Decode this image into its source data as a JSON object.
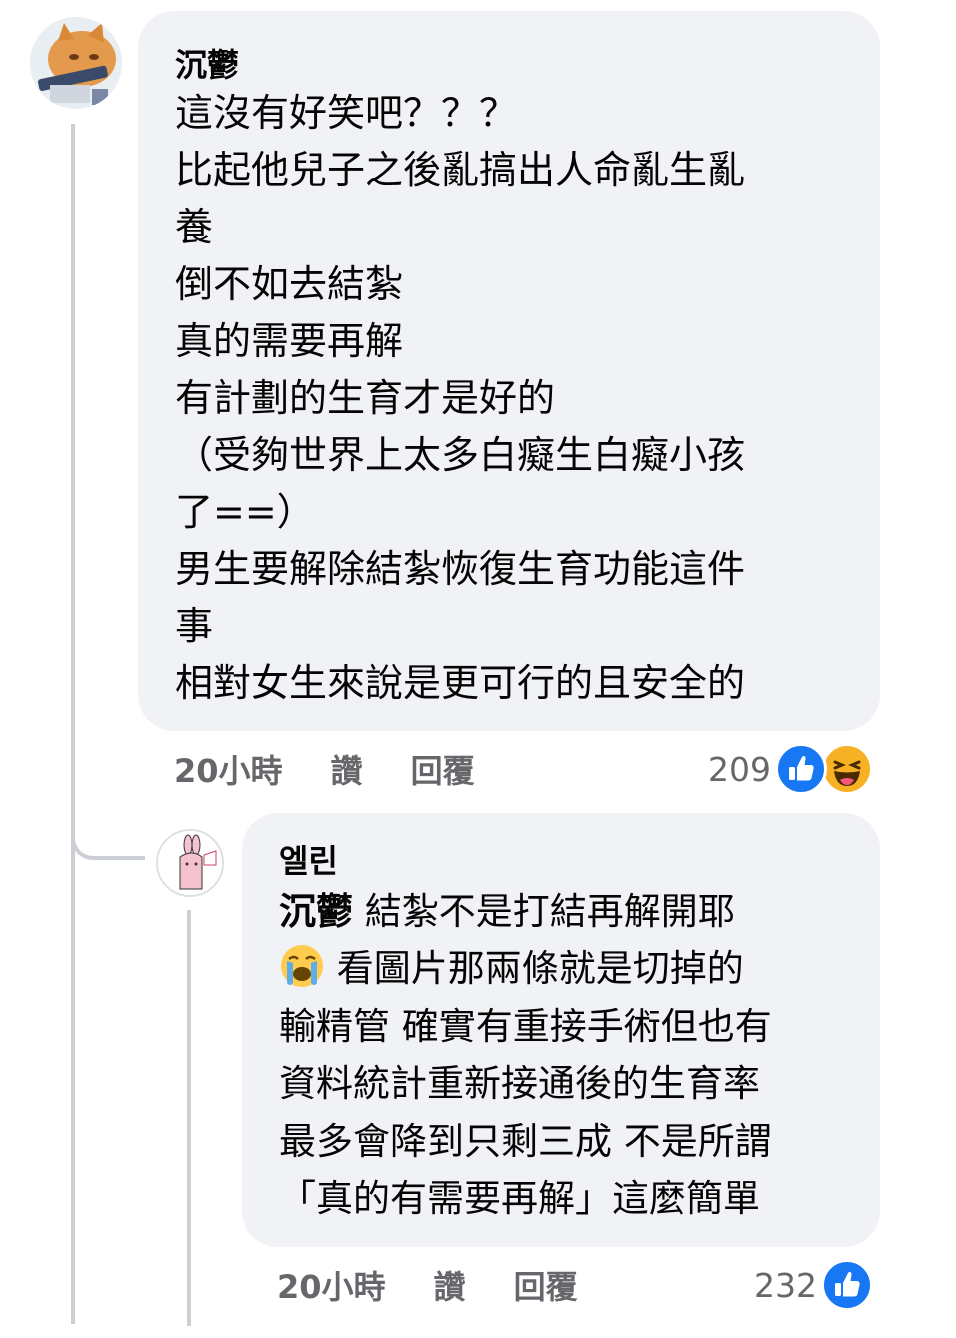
{
  "comment": {
    "author": "沉鬱",
    "lines": [
      "這沒有好笑吧？？？",
      "比起他兒子之後亂搞出人命亂生亂",
      "養",
      "倒不如去結紮",
      "真的需要再解",
      "有計劃的生育才是好的",
      "（受夠世界上太多白癡生白癡小孩",
      "了==）",
      "男生要解除結紮恢復生育功能這件",
      "事",
      "相對女生來說是更可行的且安全的"
    ],
    "time": "20小時",
    "like_label": "讚",
    "reply_label": "回覆",
    "reaction_count": "209",
    "reaction_icons": [
      "like-icon",
      "haha-icon"
    ],
    "colors": {
      "like": "#1877f2",
      "haha": "#f7b125"
    }
  },
  "reply": {
    "author": "엘린",
    "mention": "沉鬱",
    "line1_rest": " 結紮不是打結再解開耶",
    "line2_rest": " 看圖片那兩條就是切掉的",
    "emoji": "crying-face-icon",
    "lines": [
      "輸精管 確實有重接手術但也有",
      "資料統計重新接通後的生育率",
      "最多會降到只剩三成 不是所謂",
      "「真的有需要再解」這麼簡單"
    ],
    "time": "20小時",
    "like_label": "讚",
    "reply_label": "回覆",
    "reaction_count": "232",
    "reaction_icons": [
      "like-icon"
    ]
  }
}
